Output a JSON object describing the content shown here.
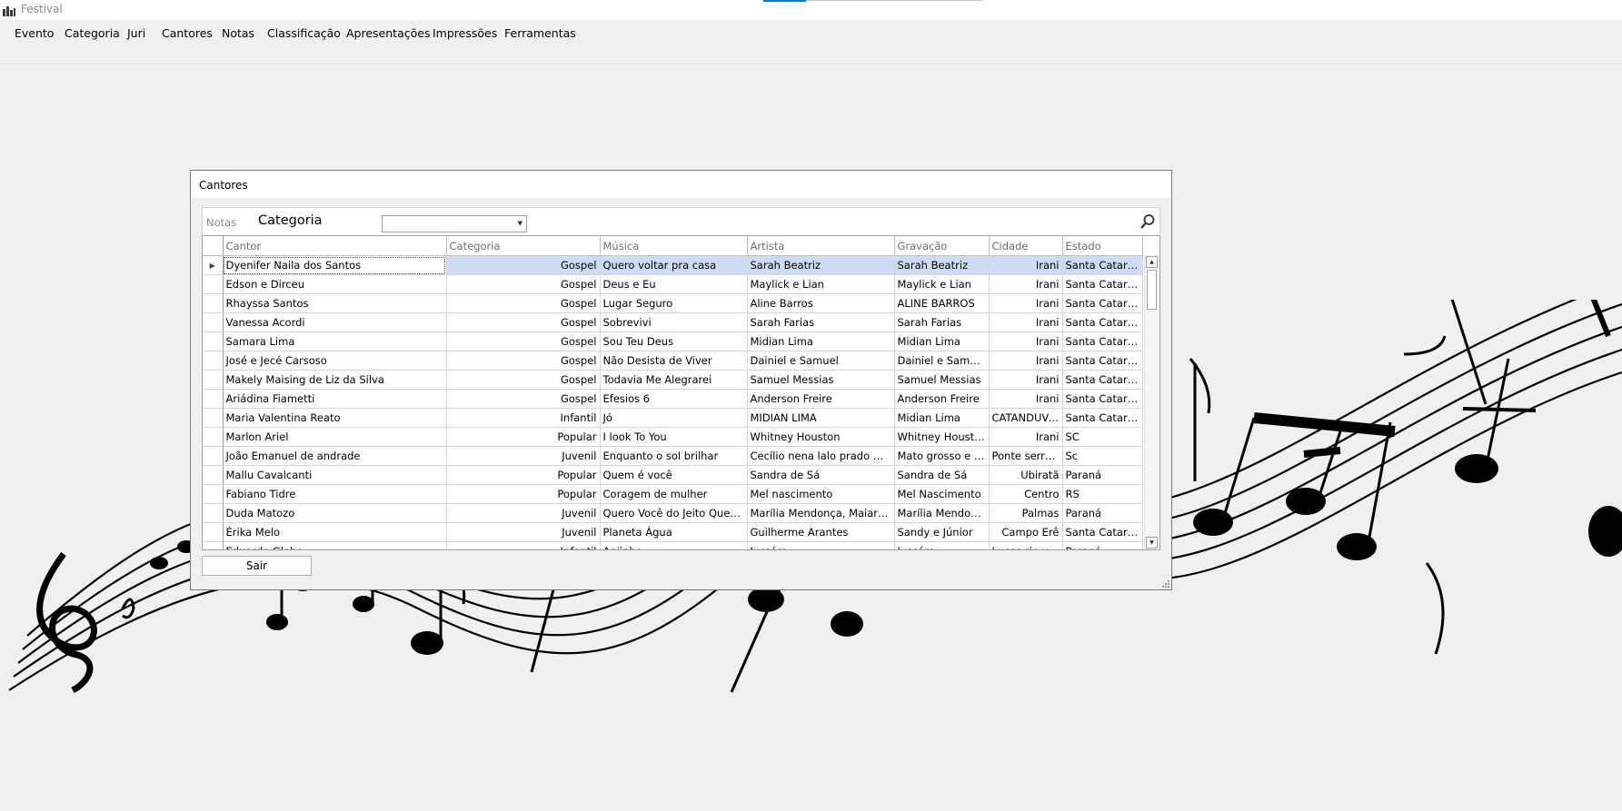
{
  "app": {
    "title": "Festival"
  },
  "menu": [
    "Evento",
    "Categoria",
    "Juri",
    "Cantores",
    "Notas",
    "Classificação",
    "Apresentações",
    "Impressões",
    "Ferramentas"
  ],
  "dialog": {
    "title": "Cantores",
    "notas_label": "Notas",
    "categoria_label": "Categoria",
    "category_combo_value": "",
    "sair_label": "Sair"
  },
  "grid": {
    "columns": [
      "Cantor",
      "Categoria",
      "Música",
      "Artista",
      "Gravação",
      "Cidade",
      "Estado"
    ],
    "selected_row": 0,
    "rows": [
      [
        "Dyenifer Naila dos Santos",
        "Gospel",
        "Quero voltar pra casa",
        "Sarah Beatriz",
        "Sarah Beatriz",
        "Irani",
        "Santa Catarina"
      ],
      [
        "Edson e Dirceu",
        "Gospel",
        "Deus e Eu",
        "Maylick e Lian",
        "Maylick e Lian",
        "Irani",
        "Santa Catarina"
      ],
      [
        "Rhayssa Santos",
        "Gospel",
        "Lugar Seguro",
        "Aline Barros",
        "ALINE BARROS",
        "Irani",
        "Santa Catarina"
      ],
      [
        "Vanessa Acordi",
        "Gospel",
        "Sobrevivi",
        "Sarah Farias",
        "Sarah Farias",
        "Irani",
        "Santa Catarina"
      ],
      [
        "Samara Lima",
        "Gospel",
        "Sou Teu Deus",
        "Midian Lima",
        "Midian Lima",
        "Irani",
        "Santa Catarina"
      ],
      [
        "José e Jecé Carsoso",
        "Gospel",
        "Não Desista de Viver",
        "Dainiel e Samuel",
        "Dainiel e Samuel",
        "Irani",
        "Santa Catarina"
      ],
      [
        "Makely Maising de Liz da Silva",
        "Gospel",
        "Todavia Me Alegrarei",
        "Samuel Messias",
        "Samuel Messias",
        "Irani",
        "Santa Catarina"
      ],
      [
        "Ariádina Fiametti",
        "Gospel",
        "Efesios 6",
        "Anderson Freire",
        "Anderson Freire",
        "Irani",
        "Santa Catarina"
      ],
      [
        "Maria Valentina Reato",
        "Infantil",
        "Jó",
        "MIDIAN LIMA",
        "Midian Lima",
        "CATANDUVAS",
        "Santa Catarina"
      ],
      [
        "Marlon Ariel",
        "Popular",
        "I look To You",
        "Whitney Houston",
        "Whitney Houston",
        "Irani",
        "SC"
      ],
      [
        "João Emanuel de andrade",
        "Juvenil",
        "Enquanto o sol brilhar",
        "Cecílio nena lalo prado mato g...",
        "Mato grosso e ma...",
        "Ponte serrada",
        "Sc"
      ],
      [
        "Mallu Cavalcanti",
        "Popular",
        "Quem é você",
        "Sandra de Sá",
        "Sandra de Sá",
        "Ubiratã",
        "Paraná"
      ],
      [
        "Fabiano Tidre",
        "Popular",
        "Coragem de mulher",
        "Mel nascimento",
        "Mel Nascimento",
        "Centro",
        "RS"
      ],
      [
        "Duda Matozo",
        "Juvenil",
        "Quero Você do Jeito Que Quiser",
        "Marília Mendonça, Maiara e M...",
        "Marília Mendonça ...",
        "Palmas",
        "Paraná"
      ],
      [
        "Érika Melo",
        "Juvenil",
        "Planeta Água",
        "Guilherme Arantes",
        "Sandy e Júnior",
        "Campo Erê",
        "Santa Catarina"
      ],
      [
        "Eduardo Gloho",
        "Infantil",
        "Anjinho",
        "Jussára",
        "Jussára",
        "Lucas rio verde",
        "Paraná"
      ]
    ]
  },
  "icons": {
    "app": "bar-chart-icon",
    "search": "search-icon"
  }
}
